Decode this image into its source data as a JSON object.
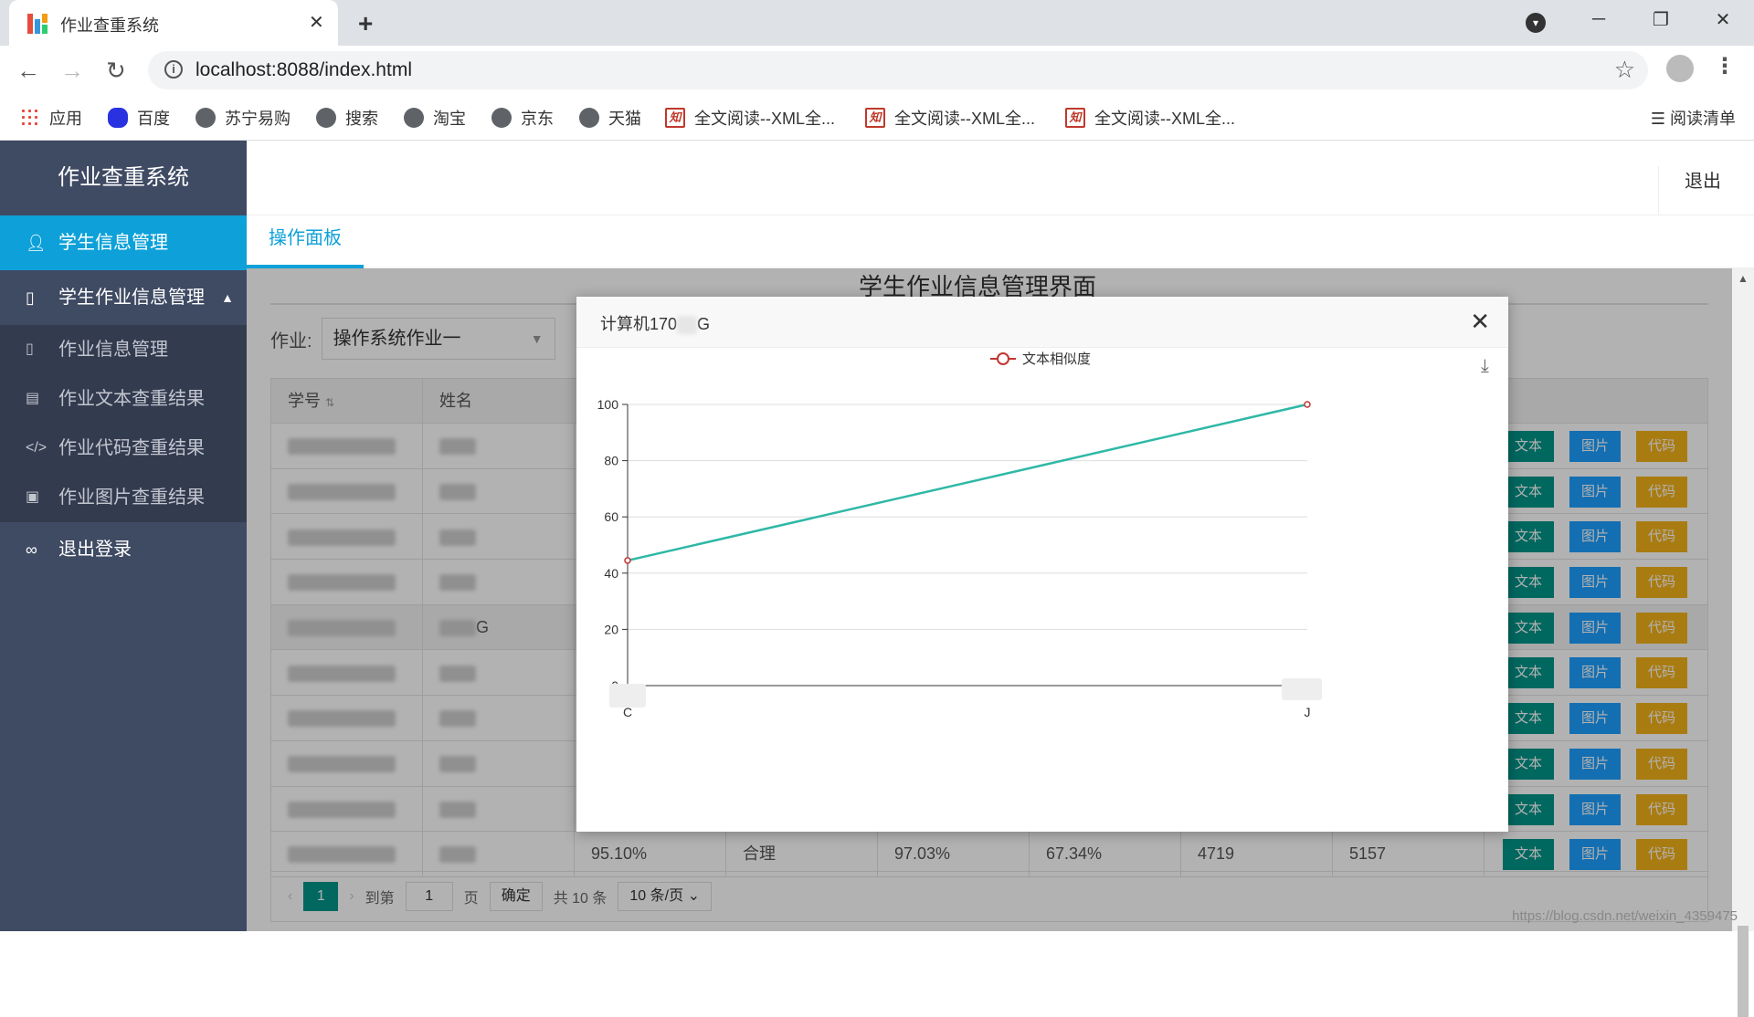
{
  "browser": {
    "tab_title": "作业查重系统",
    "tab_close": "✕",
    "new_tab": "+",
    "url": "localhost:8088/index.html",
    "bookmarks": [
      "应用",
      "百度",
      "苏宁易购",
      "搜索",
      "淘宝",
      "京东",
      "天猫",
      "全文阅读--XML全...",
      "全文阅读--XML全...",
      "全文阅读--XML全..."
    ],
    "reading_list": "阅读清单"
  },
  "app": {
    "title": "作业查重系统",
    "logout": "退出",
    "tab": "操作面板",
    "page_title": "学生作业信息管理界面"
  },
  "sidebar": {
    "items": [
      {
        "label": "学生信息管理",
        "icon": "user-icon",
        "active": true
      },
      {
        "label": "学生作业信息管理",
        "icon": "file-icon",
        "expanded": true
      },
      {
        "label": "作业信息管理",
        "icon": "file-icon"
      },
      {
        "label": "作业文本查重结果",
        "icon": "clipboard-icon"
      },
      {
        "label": "作业代码查重结果",
        "icon": "code-icon"
      },
      {
        "label": "作业图片查重结果",
        "icon": "image-icon"
      },
      {
        "label": "退出登录",
        "icon": "link-icon"
      }
    ]
  },
  "filter": {
    "label": "作业:",
    "selected": "操作系统作业一"
  },
  "table": {
    "headers": [
      "学号",
      "姓名"
    ],
    "rows_count_visible": 10,
    "last_row": [
      "95.10%",
      "合理",
      "97.03%",
      "67.34%",
      "4719",
      "5157"
    ],
    "fifth_row_name_tail": "G",
    "buttons": {
      "text": "文本",
      "image": "图片",
      "code": "代码"
    }
  },
  "pager": {
    "current": "1",
    "goto_label": "到第",
    "goto_value": "1",
    "page_unit": "页",
    "confirm": "确定",
    "total": "共 10 条",
    "per_page": "10 条/页"
  },
  "modal": {
    "title": "计算机170",
    "title_tail": "G",
    "close": "✕"
  },
  "chart_data": {
    "type": "line",
    "series": [
      {
        "name": "文本相似度",
        "x": [
          "C",
          "J"
        ],
        "values": [
          44.5,
          100
        ],
        "color": "#2eb8a6"
      }
    ],
    "yticks": [
      0,
      20,
      40,
      60,
      80,
      100
    ],
    "ylim": [
      0,
      100
    ],
    "xlabels": [
      "C",
      "J"
    ],
    "grid": true,
    "legend": "top-center"
  },
  "watermark": "https://blog.csdn.net/weixin_4359475"
}
